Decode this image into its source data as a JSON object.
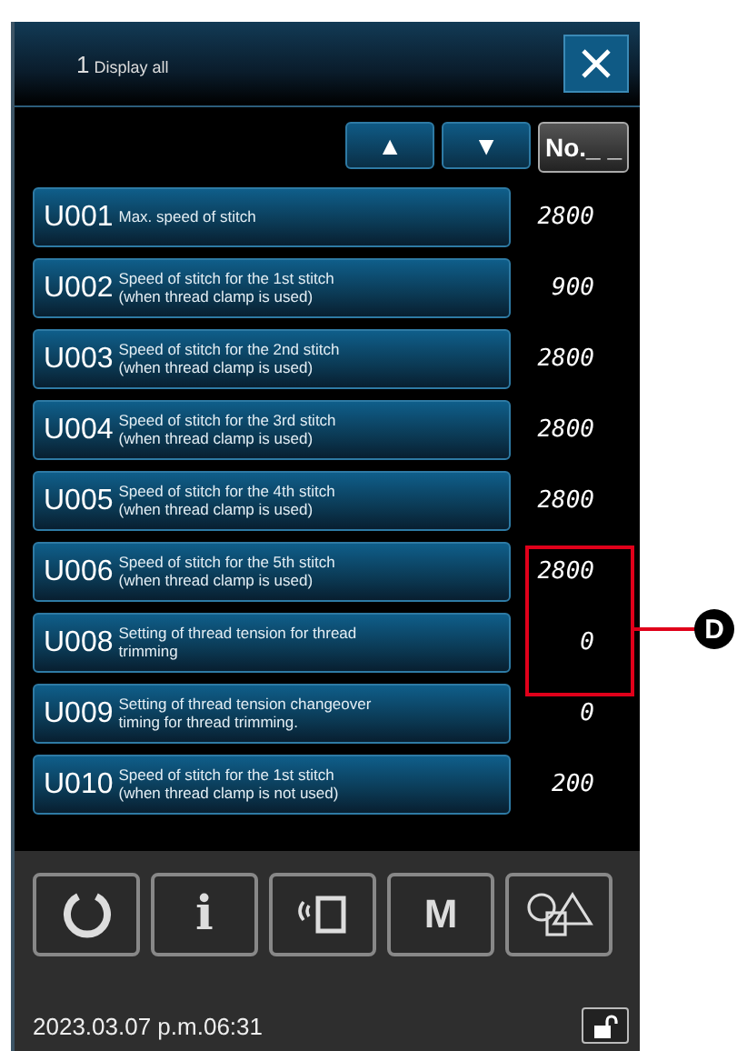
{
  "header": {
    "number": "1",
    "title": "Display all"
  },
  "toolbar": {
    "up": "▲",
    "down": "▼",
    "number_button": "No._ _"
  },
  "rows": [
    {
      "code": "U001",
      "description": "Max. speed of stitch",
      "value": "2800"
    },
    {
      "code": "U002",
      "description": "Speed of stitch for the 1st stitch\n(when thread clamp is used)",
      "value": "900"
    },
    {
      "code": "U003",
      "description": "Speed of stitch for the 2nd stitch\n(when thread clamp is used)",
      "value": "2800"
    },
    {
      "code": "U004",
      "description": "Speed of stitch for the 3rd stitch\n(when thread clamp is used)",
      "value": "2800"
    },
    {
      "code": "U005",
      "description": "Speed of stitch for the 4th stitch\n(when thread clamp is used)",
      "value": "2800"
    },
    {
      "code": "U006",
      "description": "Speed of stitch for the 5th stitch\n(when thread clamp is used)",
      "value": "2800"
    },
    {
      "code": "U008",
      "description": "Setting of thread tension for thread\ntrimming",
      "value": "0"
    },
    {
      "code": "U009",
      "description": "Setting of thread tension changeover\ntiming for thread trimming.",
      "value": "0"
    },
    {
      "code": "U010",
      "description": "Speed of stitch for the 1st stitch\n(when thread clamp is not used)",
      "value": "200"
    }
  ],
  "bottom_buttons": [
    {
      "kind": "reset"
    },
    {
      "kind": "info",
      "label": "i"
    },
    {
      "kind": "communication"
    },
    {
      "kind": "memory",
      "label": "M"
    },
    {
      "kind": "shapes"
    }
  ],
  "status_bar": {
    "datetime": "2023.03.07 p.m.06:31"
  },
  "callout": {
    "label": "D"
  }
}
